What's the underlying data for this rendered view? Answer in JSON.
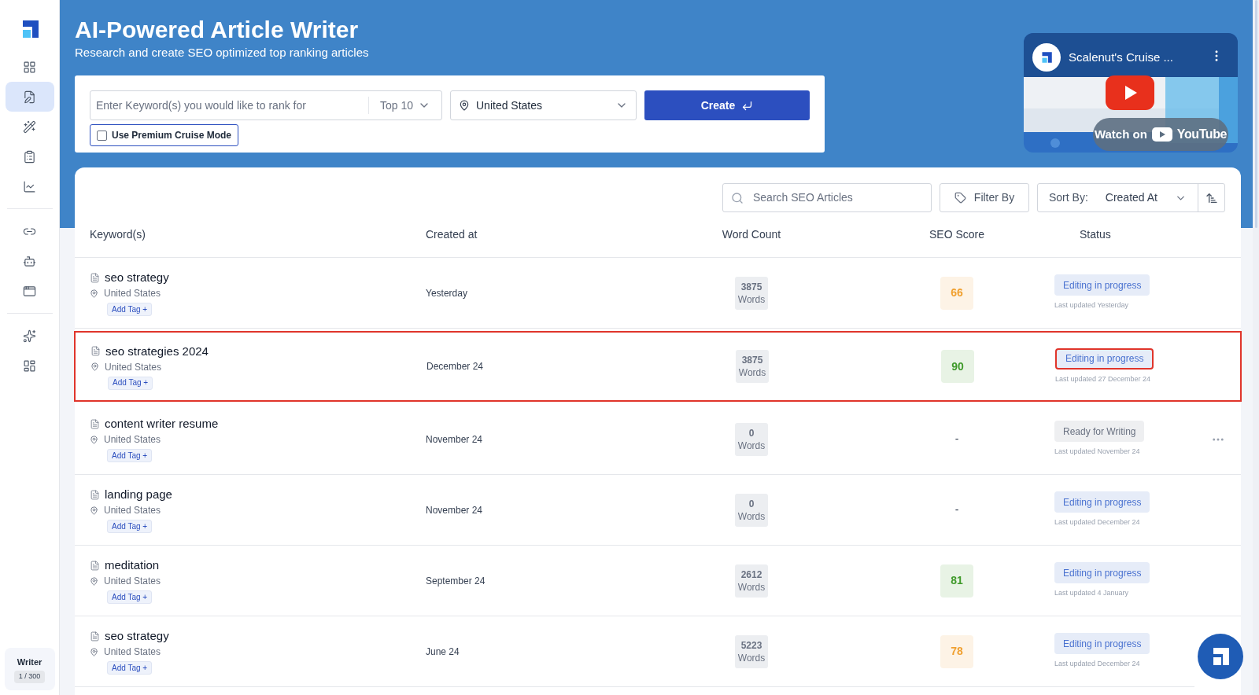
{
  "sidebar": {
    "groups": [
      [
        {
          "kind": "grid",
          "selected": false
        },
        {
          "kind": "edit",
          "selected": true
        },
        {
          "kind": "magic",
          "selected": false
        },
        {
          "kind": "clipboard",
          "selected": false
        },
        {
          "kind": "chart",
          "selected": false
        }
      ],
      [
        {
          "kind": "link",
          "selected": false
        },
        {
          "kind": "ai",
          "selected": false
        },
        {
          "kind": "browser",
          "selected": false
        }
      ],
      [
        {
          "kind": "star-search",
          "selected": false
        },
        {
          "kind": "apps",
          "selected": false
        }
      ]
    ],
    "plan": {
      "label": "Writer",
      "usage": "1 / 300"
    }
  },
  "header": {
    "title": "AI-Powered Article Writer",
    "subtitle": "Research and create SEO optimized top ranking articles"
  },
  "create_form": {
    "keyword": {
      "placeholder": "Enter Keyword(s) you would like to rank for"
    },
    "top": "Top 10",
    "location": "United States",
    "create_button": "Create",
    "premium": {
      "label": "Use Premium Cruise Mode",
      "checked": false
    }
  },
  "video": {
    "title": "Scalenut's Cruise ...",
    "watch_on": "Watch on",
    "brand": "YouTube"
  },
  "toolbar": {
    "search": {
      "placeholder": "Search SEO Articles"
    },
    "filter": "Filter By",
    "sort_label": "Sort By:",
    "sort_value": "Created At"
  },
  "table": {
    "columns": [
      "Keyword(s)",
      "Created at",
      "Word Count",
      "SEO Score",
      "Status"
    ],
    "rows": [
      {
        "keyword": "seo strategy",
        "location": "United States",
        "tag": "Add Tag +",
        "created": "Yesterday",
        "words": "3875",
        "words_label": "Words",
        "score": {
          "text": "66",
          "color": "#f0a030"
        },
        "status": {
          "kind": "editing",
          "label": "Editing in progress",
          "highlighted": false
        },
        "updated": "Last updated Yesterday",
        "highlighted": false,
        "show_menu": false
      },
      {
        "keyword": "seo strategies 2024",
        "location": "United States",
        "tag": "Add Tag +",
        "created": "December 24",
        "words": "3875",
        "words_label": "Words",
        "score": {
          "text": "90",
          "color": "#3f9a2a"
        },
        "status": {
          "kind": "editing",
          "label": "Editing in progress",
          "highlighted": true
        },
        "updated": "Last updated 27 December 24",
        "highlighted": true,
        "show_menu": false
      },
      {
        "keyword": "content writer resume",
        "location": "United States",
        "tag": "Add Tag +",
        "created": "November 24",
        "words": "0",
        "words_label": "Words",
        "score": {
          "text": "-"
        },
        "status": {
          "kind": "ready",
          "label": "Ready for Writing",
          "highlighted": false
        },
        "updated": "Last updated November 24",
        "highlighted": false,
        "show_menu": true
      },
      {
        "keyword": "landing page",
        "location": "United States",
        "tag": "Add Tag +",
        "created": "November 24",
        "words": "0",
        "words_label": "Words",
        "score": {
          "text": "-"
        },
        "status": {
          "kind": "editing",
          "label": "Editing in progress",
          "highlighted": false
        },
        "updated": "Last updated December 24",
        "highlighted": false,
        "show_menu": false
      },
      {
        "keyword": "meditation",
        "location": "United States",
        "tag": "Add Tag +",
        "created": "September 24",
        "words": "2612",
        "words_label": "Words",
        "score": {
          "text": "81",
          "color": "#3f9a2a"
        },
        "status": {
          "kind": "editing",
          "label": "Editing in progress",
          "highlighted": false
        },
        "updated": "Last updated 4 January",
        "highlighted": false,
        "show_menu": false
      },
      {
        "keyword": "seo strategy",
        "location": "United States",
        "tag": "Add Tag +",
        "created": "June 24",
        "words": "5223",
        "words_label": "Words",
        "score": {
          "text": "78",
          "color": "#f0a030"
        },
        "status": {
          "kind": "editing",
          "label": "Editing in progress",
          "highlighted": false
        },
        "updated": "Last updated December 24",
        "highlighted": false,
        "show_menu": false
      }
    ]
  }
}
